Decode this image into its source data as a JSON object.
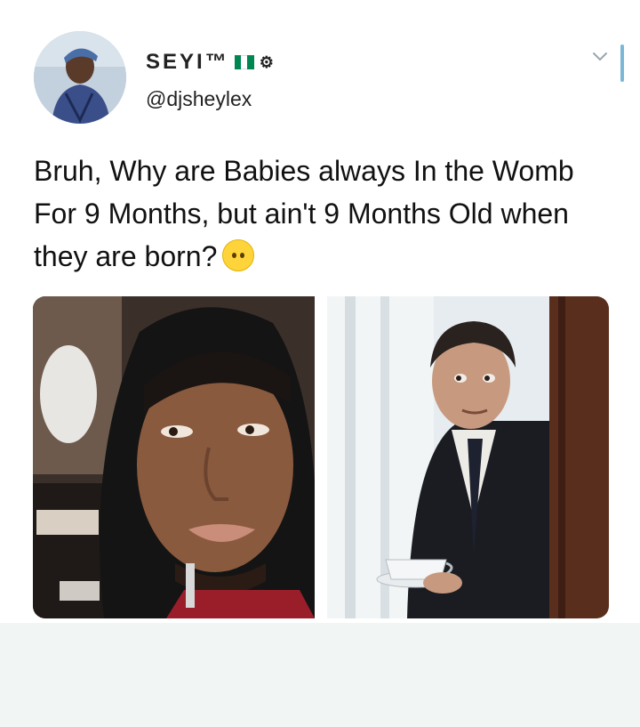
{
  "tweet": {
    "display_name": "SEYI™",
    "handle": "@djsheylex",
    "text": "Bruh, Why are Babies always In the Womb For 9 Months, but ain't 9 Months Old when they are born?",
    "emoji": "neutral-face-emoji",
    "flag_colors": [
      "#008751",
      "#ffffff",
      "#008751"
    ]
  },
  "meme": {
    "left_panel": "man-in-hoodie-thinking",
    "right_panel": "man-in-suit-with-teacup-peeking"
  },
  "colors": {
    "background": "#ffffff",
    "text": "#111111",
    "accent": "#7ab8d6"
  }
}
